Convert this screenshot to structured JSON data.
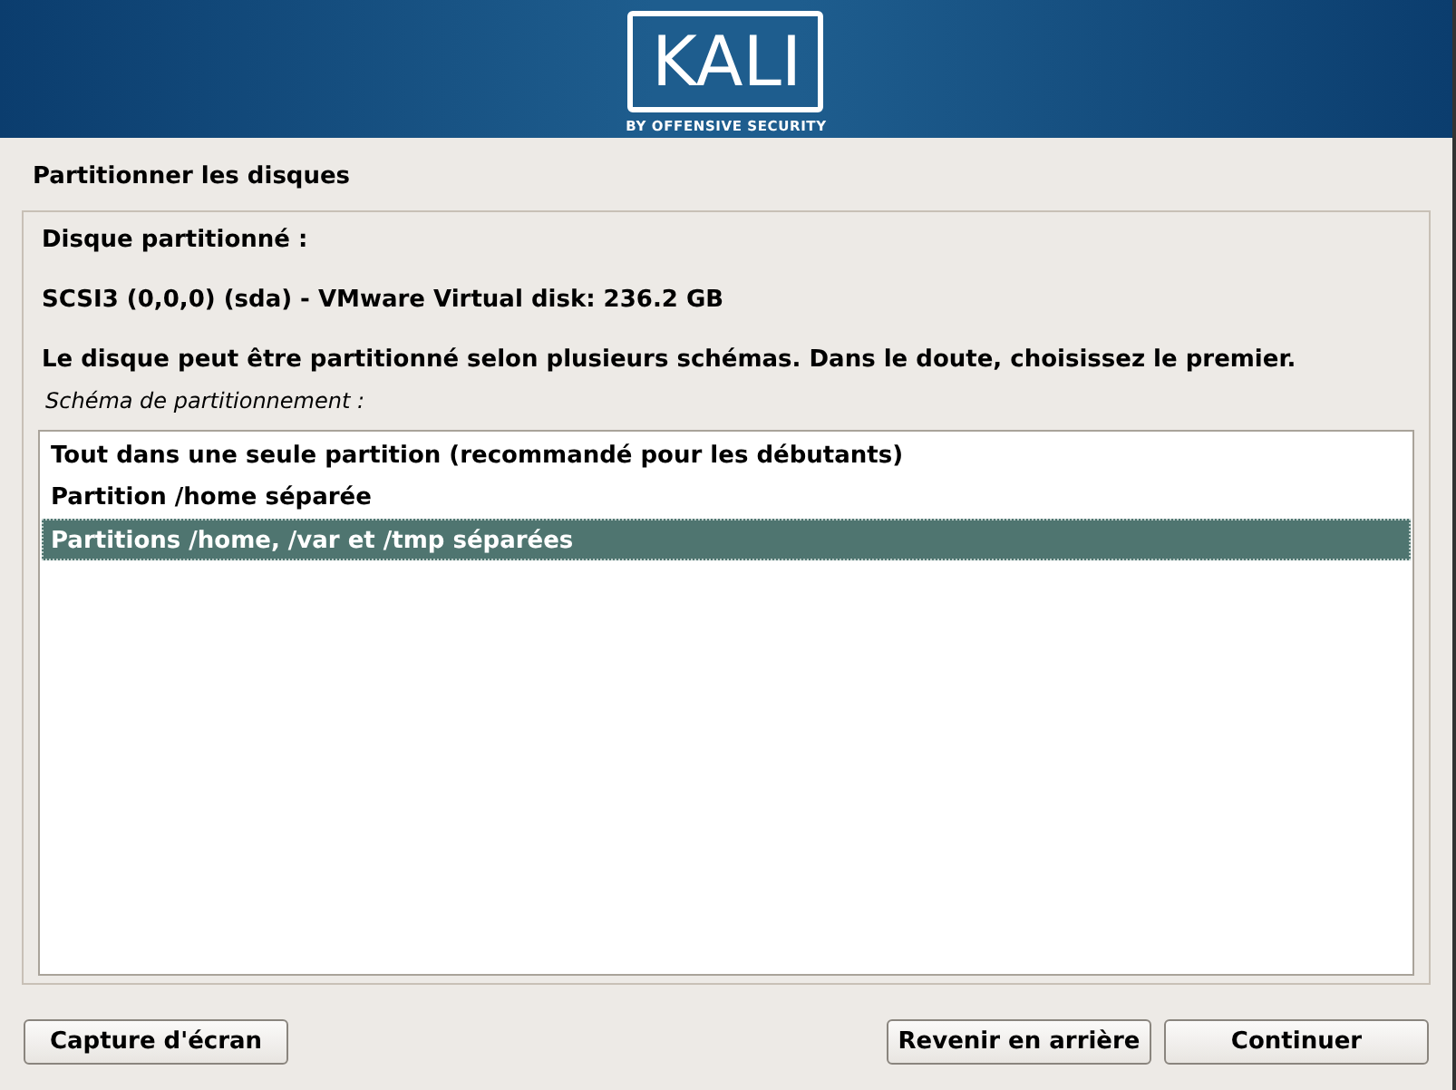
{
  "header": {
    "logo": "KALI",
    "tagline": "BY OFFENSIVE SECURITY"
  },
  "title": "Partitionner les disques",
  "disk_label": "Disque partitionné :",
  "disk": "SCSI3 (0,0,0) (sda) - VMware Virtual disk: 236.2 GB",
  "description": "Le disque peut être partitionné selon plusieurs schémas. Dans le doute, choisissez le premier.",
  "list_label": "Schéma de partitionnement :",
  "options": [
    {
      "label": "Tout dans une seule partition (recommandé pour les débutants)",
      "selected": false
    },
    {
      "label": "Partition /home séparée",
      "selected": false
    },
    {
      "label": "Partitions /home, /var et /tmp séparées",
      "selected": true
    }
  ],
  "buttons": {
    "left": "Capture d'écran",
    "back": "Revenir en arrière",
    "continue": "Continuer"
  }
}
